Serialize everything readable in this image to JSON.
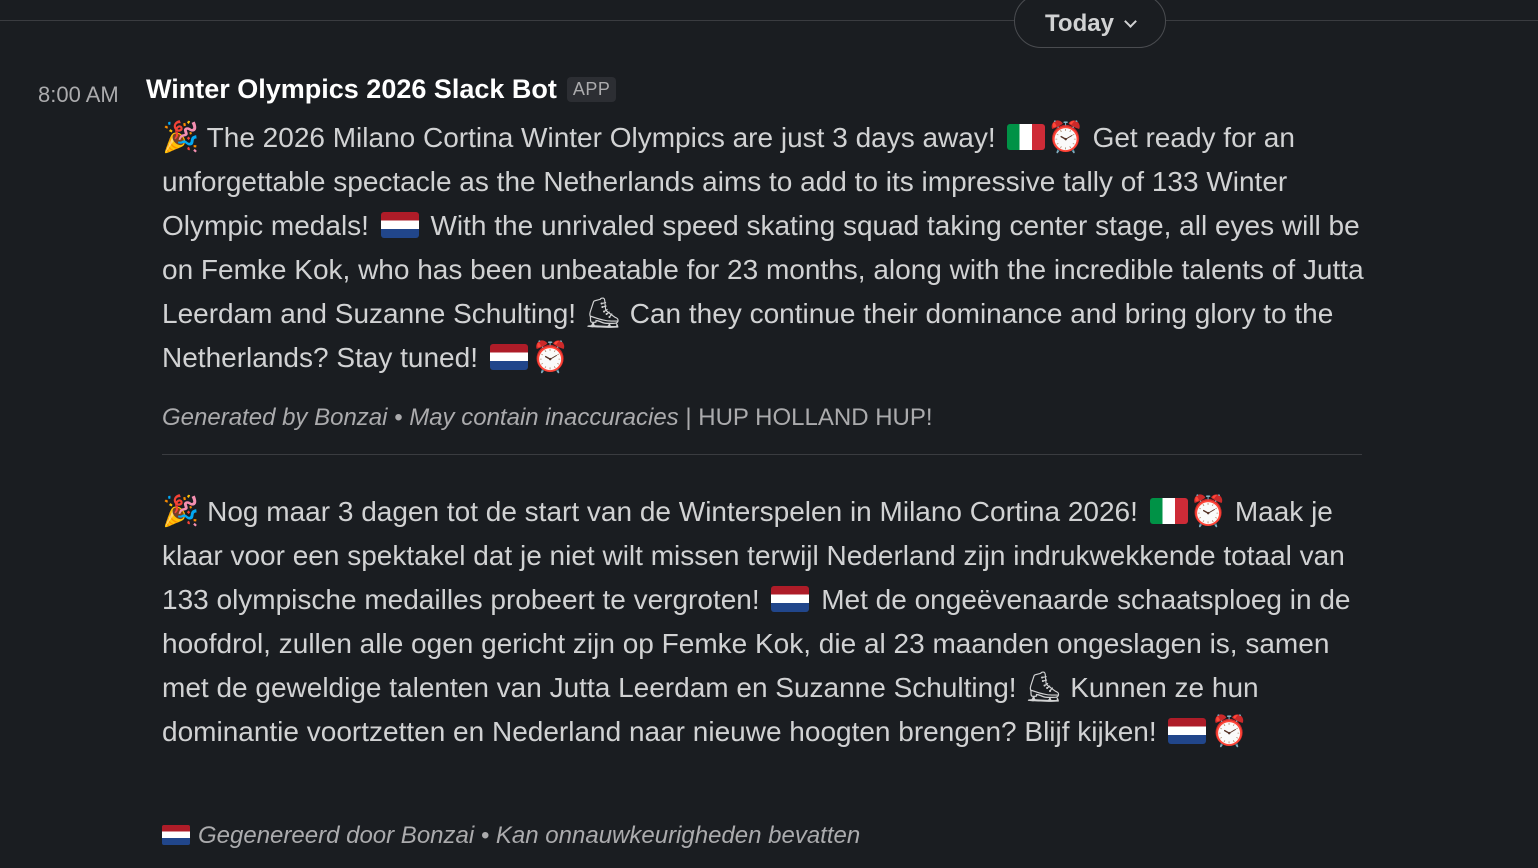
{
  "date_divider": {
    "label": "Today"
  },
  "message": {
    "timestamp": "8:00 AM",
    "sender": "Winter Olympics 2026 Slack Bot",
    "badge": "APP",
    "en": {
      "p1": "The 2026 Milano Cortina Winter Olympics are just 3 days away!",
      "p2": "Get ready for an unforgettable spectacle as the Netherlands aims to add to its impressive tally of 133 Winter Olympic medals!",
      "p3": "With the unrivaled speed skating squad taking center stage, all eyes will be on Femke Kok, who has been unbeatable for 23 months, along with the incredible talents of Jutta Leerdam and Suzanne Schulting!",
      "p4": "Can they continue their dominance and bring glory to the Netherlands? Stay tuned!",
      "footer_italic": "Generated by Bonzai • May contain inaccuracies",
      "footer_plain": " | HUP HOLLAND HUP!"
    },
    "nl": {
      "p1": "Nog maar 3 dagen tot de start van de Winterspelen in Milano Cortina 2026!",
      "p2": "Maak je klaar voor een spektakel dat je niet wilt missen terwijl Nederland zijn indrukwekkende totaal van 133 olympische medailles probeert te vergroten!",
      "p3": "Met de ongeëvenaarde schaatsploeg in de hoofdrol, zullen alle ogen gericht zijn op Femke Kok, die al 23 maanden ongeslagen is, samen met de geweldige talenten van Jutta Leerdam en Suzanne Schulting!",
      "p4": "Kunnen ze hun dominantie voortzetten en Nederland naar nieuwe hoogten brengen? Blijf kijken!",
      "footer_italic": "Gegenereerd door Bonzai • Kan onnauwkeurigheden bevatten"
    }
  },
  "icons": {
    "party": "🎉",
    "alarm": "⏰",
    "skate": "⛸"
  }
}
